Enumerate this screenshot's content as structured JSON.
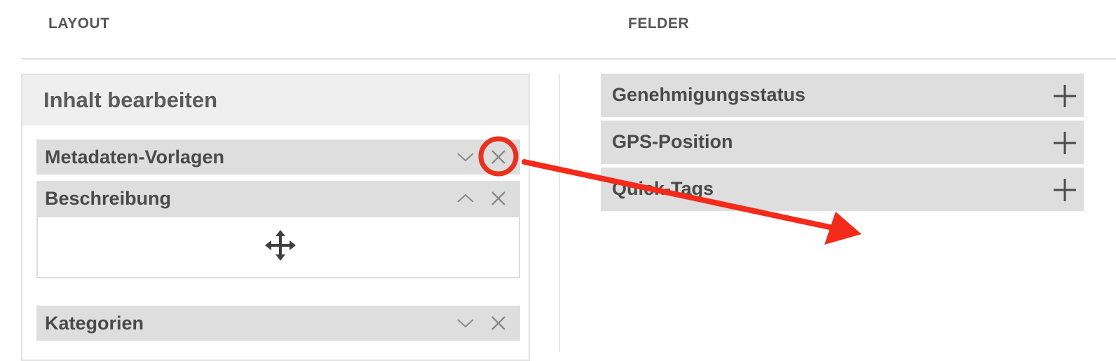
{
  "headers": {
    "layout": "LAYOUT",
    "fields": "FELDER"
  },
  "layout_panel": {
    "title": "Inhalt bearbeiten",
    "sections": [
      {
        "label": "Metadaten-Vorlagen",
        "toggle_icon": "chevron-down-icon",
        "remove_icon": "close-icon",
        "expanded": false
      },
      {
        "label": "Beschreibung",
        "toggle_icon": "chevron-up-icon",
        "remove_icon": "close-icon",
        "expanded": true,
        "body_icon": "move-icon"
      },
      {
        "label": "Kategorien",
        "toggle_icon": "chevron-down-icon",
        "remove_icon": "close-icon",
        "expanded": false
      }
    ]
  },
  "fields_panel": {
    "items": [
      {
        "label": "Genehmigungsstatus",
        "action_icon": "plus-icon"
      },
      {
        "label": "GPS-Position",
        "action_icon": "plus-icon"
      },
      {
        "label": "Quick-Tags",
        "action_icon": "plus-icon"
      }
    ]
  },
  "annotation": {
    "highlight_color": "#e8311f",
    "arrow_color": "#f42a1a",
    "highlight_icon": "close-icon"
  },
  "colors": {
    "row_background": "#dedede",
    "panel_header_background": "#efefef",
    "text": "#4a4a4a",
    "icon": "#8a8a8a"
  }
}
